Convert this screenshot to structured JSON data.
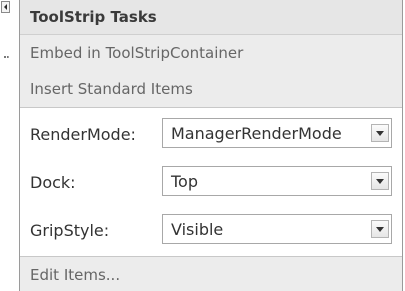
{
  "panel": {
    "title": "ToolStrip Tasks",
    "actions": {
      "embed": "Embed in ToolStripContainer",
      "insert": "Insert Standard Items",
      "edit": "Edit Items..."
    },
    "properties": [
      {
        "label": "RenderMode:",
        "value": "ManagerRenderMode"
      },
      {
        "label": "Dock:",
        "value": "Top"
      },
      {
        "label": "GripStyle:",
        "value": "Visible"
      }
    ]
  },
  "icons": {
    "collapse": "left-arrow-icon",
    "dropdown": "chevron-down-icon",
    "grip": "dotted-grip-icon"
  },
  "colors": {
    "panel_background": "#ececec",
    "property_background": "#ffffff",
    "border": "#9a9a9a",
    "text": "#333333"
  }
}
